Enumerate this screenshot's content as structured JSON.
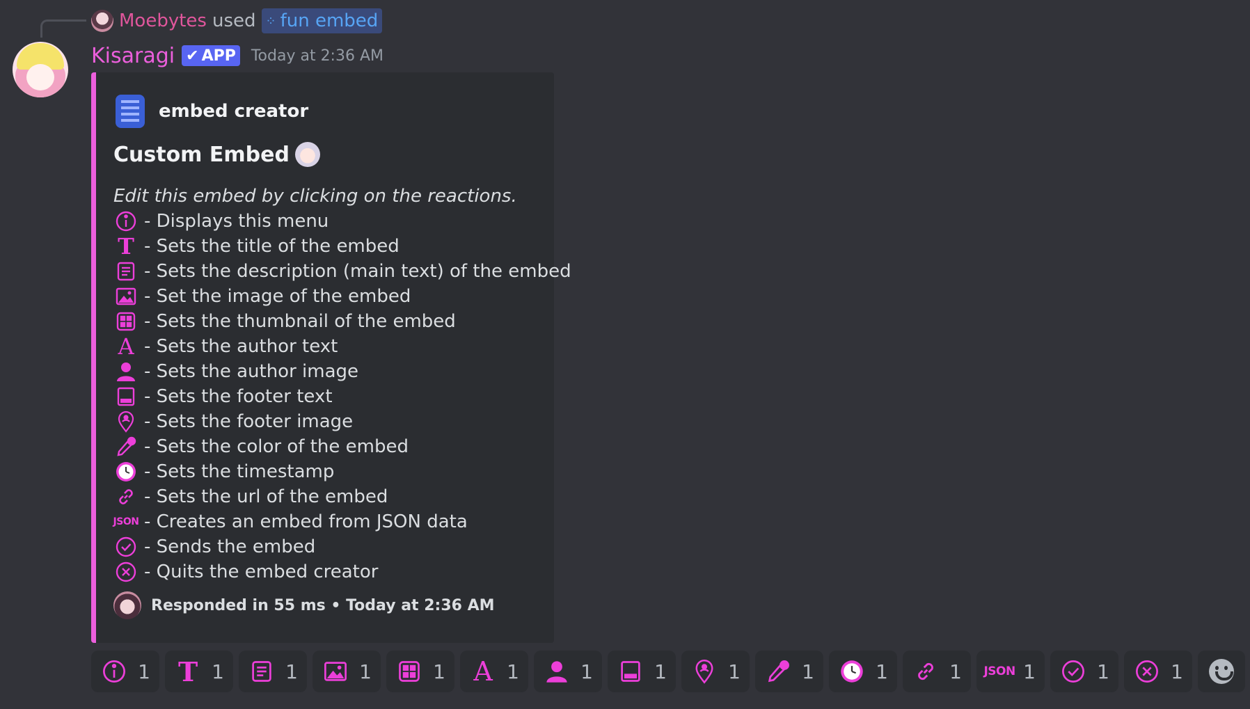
{
  "reply": {
    "user": "Moebytes",
    "used": "used",
    "command": "fun embed"
  },
  "message": {
    "bot_name": "Kisaragi",
    "app_tag": "APP",
    "timestamp": "Today at 2:36 AM"
  },
  "embed": {
    "accent_color": "#ec5fdc",
    "author": "embed creator",
    "title": "Custom Embed",
    "intro": "Edit this embed by clicking on the reactions.",
    "lines": [
      {
        "icon": "info-icon",
        "text": "- Displays this menu"
      },
      {
        "icon": "title-t-icon",
        "text": "- Sets the title of the embed"
      },
      {
        "icon": "description-icon",
        "text": "- Sets the description (main text) of the embed"
      },
      {
        "icon": "image-icon",
        "text": "- Set the image of the embed"
      },
      {
        "icon": "thumbnail-grid-icon",
        "text": "- Sets the thumbnail of the embed"
      },
      {
        "icon": "author-a-icon",
        "text": "- Sets the author text"
      },
      {
        "icon": "person-icon",
        "text": "- Sets the author image"
      },
      {
        "icon": "footer-icon",
        "text": "- Sets the footer text"
      },
      {
        "icon": "footer-image-pin-icon",
        "text": "- Sets the footer image"
      },
      {
        "icon": "eyedropper-icon",
        "text": "- Sets the color of the embed"
      },
      {
        "icon": "clock-icon",
        "text": "- Sets the timestamp"
      },
      {
        "icon": "link-icon",
        "text": "- Sets the url of the embed"
      },
      {
        "icon": "json-icon",
        "text": "- Creates an embed from JSON data"
      },
      {
        "icon": "check-circle-icon",
        "text": "- Sends the embed"
      },
      {
        "icon": "x-circle-icon",
        "text": "- Quits the embed creator"
      }
    ],
    "footer": "Responded in 55 ms • Today at 2:36 AM"
  },
  "reactions": [
    {
      "icon": "info-icon",
      "count": "1"
    },
    {
      "icon": "title-t-icon",
      "count": "1"
    },
    {
      "icon": "description-icon",
      "count": "1"
    },
    {
      "icon": "image-icon",
      "count": "1"
    },
    {
      "icon": "thumbnail-grid-icon",
      "count": "1"
    },
    {
      "icon": "author-a-icon",
      "count": "1"
    },
    {
      "icon": "person-icon",
      "count": "1"
    },
    {
      "icon": "footer-icon",
      "count": "1"
    },
    {
      "icon": "footer-image-pin-icon",
      "count": "1"
    },
    {
      "icon": "eyedropper-icon",
      "count": "1"
    },
    {
      "icon": "clock-icon",
      "count": "1"
    },
    {
      "icon": "link-icon",
      "count": "1"
    },
    {
      "icon": "json-icon",
      "count": "1"
    },
    {
      "icon": "check-circle-icon",
      "count": "1"
    },
    {
      "icon": "x-circle-icon",
      "count": "1"
    }
  ],
  "icon_color": "#ec3fd9",
  "json_label": "JSON"
}
